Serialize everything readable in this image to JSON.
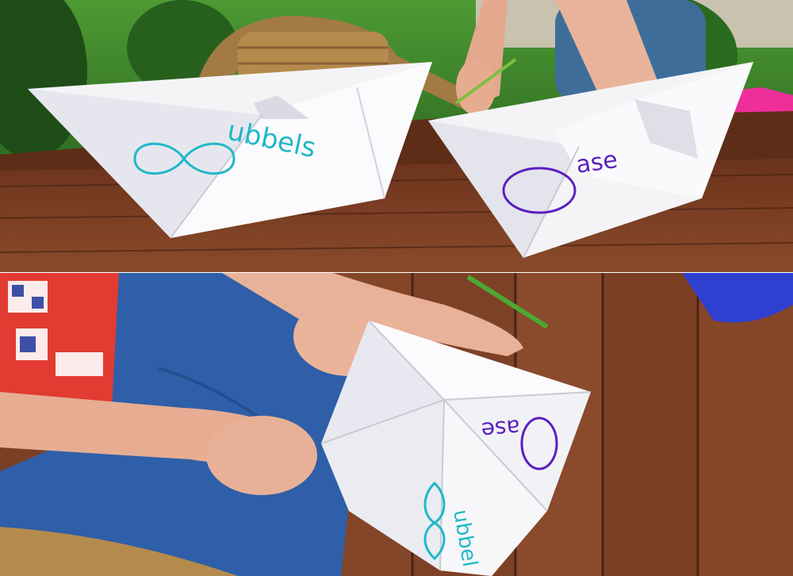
{
  "top_photo": {
    "boat_left": {
      "word_suffix": "ubbels",
      "color": "#1fb8c8"
    },
    "boat_right": {
      "word_suffix": "ase",
      "color": "#5a1fc0"
    }
  },
  "bottom_photo": {
    "fortune_teller": {
      "flap_top_word_suffix": "ase",
      "flap_top_color": "#5a1fc0",
      "flap_bottom_word_suffix": "ubbel",
      "flap_bottom_color": "#1fb8c8"
    }
  },
  "colors": {
    "table_wood": "#7a3f25",
    "paper": "#f4f4f7",
    "grass": "#3f8a2a",
    "notebook_pink": "#ee2f9a",
    "shirt_red": "#e23b32",
    "jeans_blue": "#2f5fa8"
  }
}
